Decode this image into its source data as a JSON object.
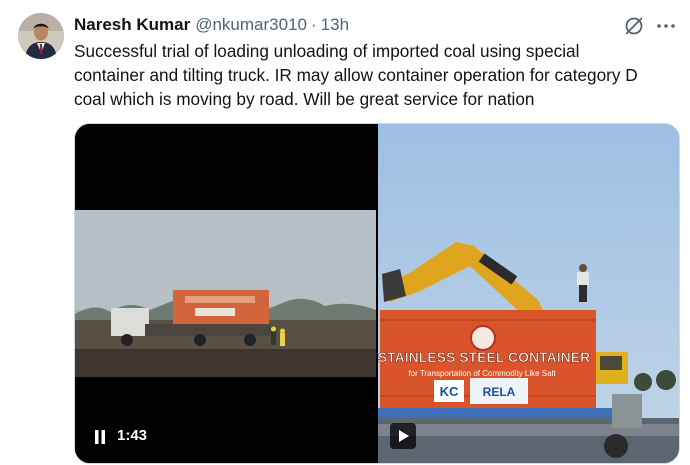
{
  "author": {
    "name": "Naresh Kumar",
    "handle": "@nkumar3010",
    "separator": "·",
    "time": "13h"
  },
  "tweet_text": "Successful trial of loading unloading of imported coal using special\ncontainer and tilting truck. IR may allow container operation for category D\ncoal which is moving by road. Will be great service for nation",
  "media": {
    "left_video": {
      "duration": "1:43"
    },
    "right_video": {
      "container_title": "STAINLESS STEEL CONTAINER",
      "container_subtitle": "for Transportation of Commodity Like Salt",
      "brand_left": "KC",
      "brand_right": "RELA"
    }
  },
  "icons": [
    "grok-icon",
    "more-icon",
    "pause-icon",
    "play-icon"
  ],
  "colors": {
    "text": "#0f1419",
    "secondary": "#536471",
    "border": "#cfd9de",
    "container": "#d9542b"
  }
}
